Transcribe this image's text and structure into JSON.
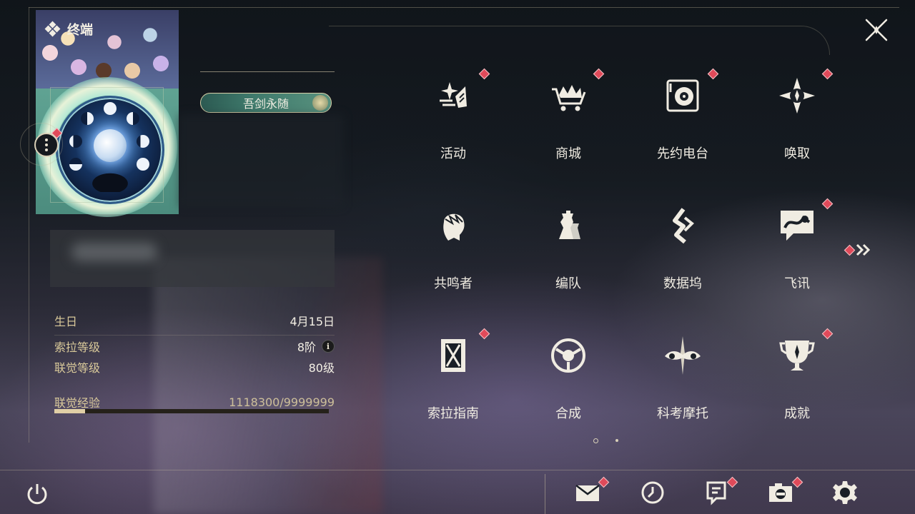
{
  "header": {
    "title": "终端"
  },
  "profile": {
    "title_badge": "吾剑永随",
    "stats": {
      "birthday_label": "生日",
      "birthday_value": "4月15日",
      "sola_level_label": "索拉等级",
      "sola_level_value": "8阶",
      "union_level_label": "联觉等级",
      "union_level_value": "80级",
      "union_exp_label": "联觉经验",
      "union_exp_value": "1118300/9999999"
    },
    "exp_progress": 0.112
  },
  "menu": {
    "items": [
      {
        "label": "活动",
        "icon": "sparkle-icon",
        "badge": true
      },
      {
        "label": "商城",
        "icon": "shop-basket-icon",
        "badge": true
      },
      {
        "label": "先约电台",
        "icon": "radio-icon",
        "badge": true
      },
      {
        "label": "唤取",
        "icon": "compass-star-icon",
        "badge": true
      },
      {
        "label": "共鸣者",
        "icon": "character-head-icon",
        "badge": false
      },
      {
        "label": "编队",
        "icon": "team-chess-icon",
        "badge": false
      },
      {
        "label": "数据坞",
        "icon": "data-dock-icon",
        "badge": false
      },
      {
        "label": "飞讯",
        "icon": "chat-message-icon",
        "badge": true
      },
      {
        "label": "索拉指南",
        "icon": "guide-book-icon",
        "badge": true
      },
      {
        "label": "合成",
        "icon": "synthesis-icon",
        "badge": false
      },
      {
        "label": "科考摩托",
        "icon": "motorcycle-icon",
        "badge": false
      },
      {
        "label": "成就",
        "icon": "trophy-icon",
        "badge": true
      }
    ],
    "page_count": 2,
    "current_page": 1
  },
  "footer": {
    "icons": [
      "power-icon",
      "mail-icon",
      "clock-icon",
      "notice-icon",
      "camera-icon",
      "settings-gear-icon"
    ]
  },
  "colors": {
    "accent_gold": "#d9c99a",
    "badge_red": "#e04a5a",
    "text_light": "#f0ece2"
  }
}
